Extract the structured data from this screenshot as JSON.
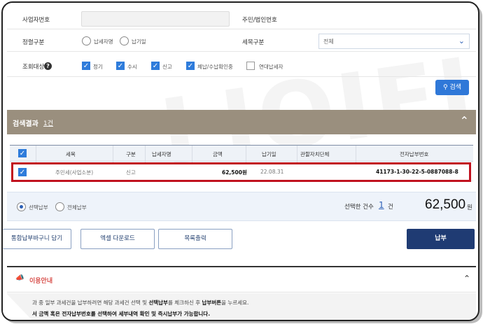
{
  "form": {
    "biz_no_label": "사업자번호",
    "resident_no_label": "주민/법인번호",
    "sort_label": "정렬구분",
    "sort_options": [
      "납세자명",
      "납기일"
    ],
    "tax_item_label": "세목구분",
    "tax_item_selected": "전체",
    "query_target_label": "조회대상",
    "query_targets": [
      {
        "label": "정기",
        "checked": true
      },
      {
        "label": "수시",
        "checked": true
      },
      {
        "label": "신고",
        "checked": true
      },
      {
        "label": "체납/수납확인중",
        "checked": true
      },
      {
        "label": "연대납세자",
        "checked": false
      }
    ],
    "search_label": "검색"
  },
  "results": {
    "title": "검색결과",
    "count": "1건",
    "columns": [
      "세목",
      "구분",
      "납세자명",
      "금액",
      "납기일",
      "관할자치단체",
      "전자납부번호"
    ],
    "rows": [
      {
        "tax_item": "주민세(사업소분)",
        "type": "신고",
        "taxpayer": "",
        "amount": "62,500원",
        "due": "22.08.31",
        "authority": "",
        "epay_no": "41173-1-30-22-5-0887088-8"
      }
    ]
  },
  "payment_mode": {
    "options": [
      "선택납부",
      "전체납부"
    ],
    "selected": "선택납부"
  },
  "summary": {
    "label": "선택한 건수",
    "count": "1",
    "unit": "건",
    "amount": "62,500",
    "won": "원"
  },
  "actions": {
    "cart": "통합납부바구니 담기",
    "excel": "엑셀 다운로드",
    "print": "목록출력",
    "pay": "납부"
  },
  "guide": {
    "title": "이용안내",
    "line1_a": "과 중 일부 과세건을 납부하려면 해당 과세건 선택 및 ",
    "line1_b": "선택납부",
    "line1_c": "를 체크하신 후 ",
    "line1_d": "납부버튼",
    "line1_e": "을 누르세요.",
    "line2": "서 금액 혹은 전자납부번호를 선택하여 세부내역 확인 및 즉시납부가 가능합니다."
  },
  "colors": {
    "accent": "#2f78d8",
    "header_bar": "#9a8f7e",
    "highlight": "#c1121f",
    "pay_button": "#1f3b73"
  }
}
